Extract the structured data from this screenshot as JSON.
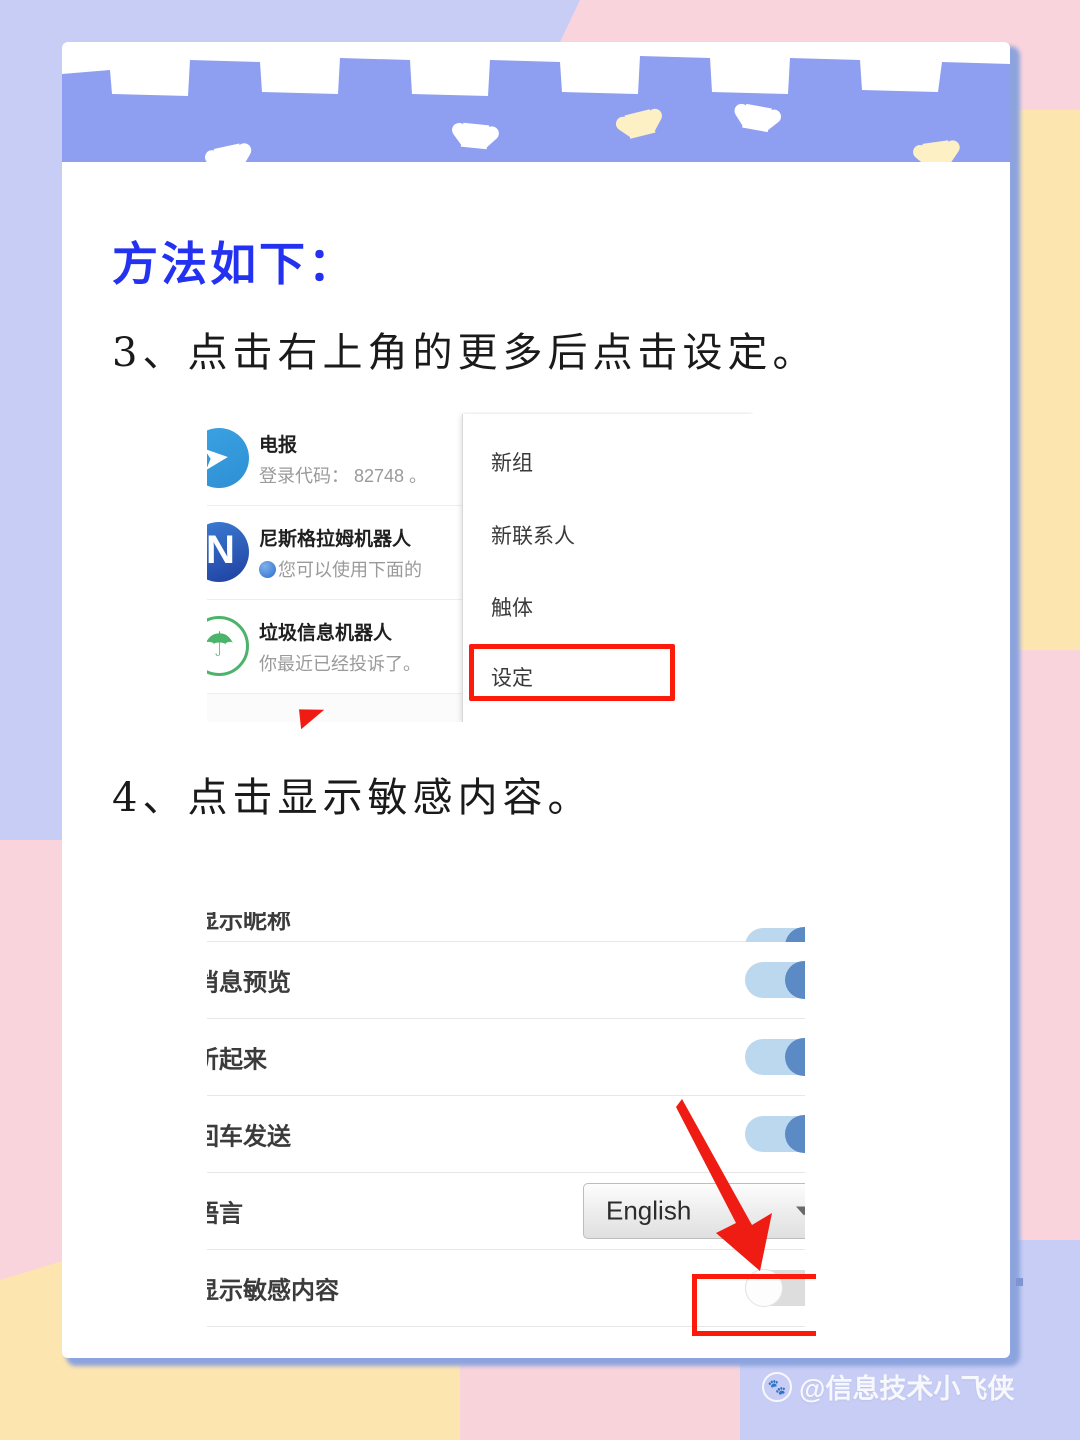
{
  "title": "方法如下：",
  "steps": [
    {
      "id": "step3",
      "text": "3、点击右上角的更多后点击设定。"
    },
    {
      "id": "step4",
      "text": "4、点击显示敏感内容。"
    }
  ],
  "screenshot_chat": {
    "chats": [
      {
        "avatar_icon": "telegram-plane-icon",
        "name": "电报",
        "message": "登录代码： 82748 。"
      },
      {
        "avatar_icon": "nicegram-bot-icon",
        "name": "尼斯格拉姆机器人",
        "message": "您可以使用下面的",
        "has_blue_dot": true
      },
      {
        "avatar_icon": "spam-bot-icon",
        "name": "垃圾信息机器人",
        "message": "你最近已经投诉了。"
      }
    ],
    "menu": {
      "items": [
        {
          "label": "新组",
          "highlighted": false
        },
        {
          "label": "新联系人",
          "highlighted": false
        },
        {
          "label": "触体",
          "highlighted": false
        },
        {
          "label": "设定",
          "highlighted": true
        }
      ]
    }
  },
  "screenshot_settings": {
    "rows": [
      {
        "label": "显示昵称",
        "control": "toggle",
        "state": "on",
        "clipped": true
      },
      {
        "label": "消息预览",
        "control": "toggle",
        "state": "on"
      },
      {
        "label": "听起来",
        "control": "toggle",
        "state": "on"
      },
      {
        "label": "回车发送",
        "control": "toggle",
        "state": "on"
      },
      {
        "label": "语言",
        "control": "select",
        "value": "English"
      },
      {
        "label": "显示敏感内容",
        "control": "toggle",
        "state": "off",
        "highlighted": true
      }
    ]
  },
  "annotations": {
    "highlight_color": "#fc1b0b",
    "arrow_color": "#ee1c12"
  },
  "watermark": {
    "icon": "baidu-paw-icon",
    "text": "@信息技术小飞侠"
  },
  "colors": {
    "title_blue": "#2331f0",
    "strip_blue": "#8e9ef0",
    "bg_lavender": "#c7cdf5",
    "bg_pink": "#fad4dd",
    "bg_yellow": "#fde5b0",
    "toggle_on_track": "#bcd8ef",
    "toggle_on_knob": "#5b8ac5",
    "toggle_off_track": "#dddddd"
  }
}
